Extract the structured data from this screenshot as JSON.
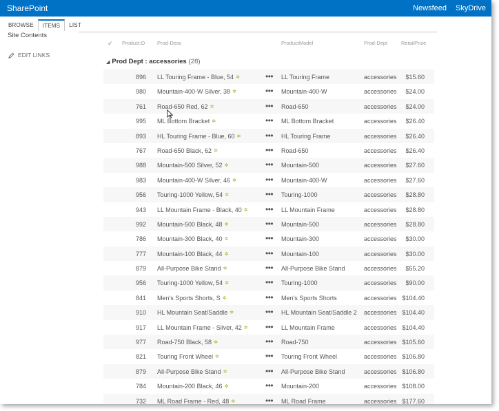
{
  "suitebar": {
    "brand": "SharePoint",
    "links": [
      "Newsfeed",
      "SkyDrive"
    ]
  },
  "ribbon": {
    "tabs": [
      "BROWSE",
      "ITEMS",
      "LIST"
    ],
    "selected_tab": "ITEMS"
  },
  "nav": {
    "site_contents": "Site Contents",
    "edit_links": "EDIT LINKS"
  },
  "columns": {
    "check": "✓",
    "id": "Product:D",
    "desc": "Prod-Desc",
    "model": "ProductModel",
    "dept": "Prod-Dept",
    "price": "RetailPrize"
  },
  "group": {
    "label": "Prod Dept : accessories",
    "count": "(28)"
  },
  "rows": [
    {
      "id": "896",
      "desc": "LL Touring Frame - Blue, 54",
      "model": "LL Touring Frame",
      "dept": "accessories",
      "price": "$15.60"
    },
    {
      "id": "980",
      "desc": "Mountain-400-W Silver, 38",
      "model": "Mountain-400-W",
      "dept": "accessories",
      "price": "$24.00"
    },
    {
      "id": "761",
      "desc": "Road-650 Red, 62",
      "model": "Road-650",
      "dept": "accessories",
      "price": "$24.00"
    },
    {
      "id": "995",
      "desc": "ML Bottom Bracket",
      "model": "ML Bottom Bracket",
      "dept": "accessories",
      "price": "$26.40"
    },
    {
      "id": "893",
      "desc": "HL Touring Frame - Blue, 60",
      "model": "HL Touring Frame",
      "dept": "accessories",
      "price": "$26.40"
    },
    {
      "id": "767",
      "desc": "Road-650 Black, 62",
      "model": "Road-650",
      "dept": "accessories",
      "price": "$26.40"
    },
    {
      "id": "988",
      "desc": "Mountain-500 Silver, 52",
      "model": "Mountain-500",
      "dept": "accessories",
      "price": "$27.60"
    },
    {
      "id": "983",
      "desc": "Mountain-400-W Silver, 46",
      "model": "Mountain-400-W",
      "dept": "accessories",
      "price": "$27.60"
    },
    {
      "id": "956",
      "desc": "Touring-1000 Yellow, 54",
      "model": "Touring-1000",
      "dept": "accessories",
      "price": "$28.80"
    },
    {
      "id": "943",
      "desc": "LL Mountain Frame - Black, 40",
      "model": "LL Mountain Frame",
      "dept": "accessories",
      "price": "$28.80"
    },
    {
      "id": "992",
      "desc": "Mountain-500 Black, 48",
      "model": "Mountain-500",
      "dept": "accessories",
      "price": "$28.80"
    },
    {
      "id": "786",
      "desc": "Mountain-300 Black, 40",
      "model": "Mountain-300",
      "dept": "accessories",
      "price": "$30.00"
    },
    {
      "id": "777",
      "desc": "Mountain-100 Black, 44",
      "model": "Mountain-100",
      "dept": "accessories",
      "price": "$30.00"
    },
    {
      "id": "879",
      "desc": "All-Purpose Bike Stand",
      "model": "All-Purpose Bike Stand",
      "dept": "accessories",
      "price": "$55.20"
    },
    {
      "id": "956",
      "desc": "Touring-1000 Yellow, 54",
      "model": "Touring-1000",
      "dept": "accessories",
      "price": "$90.00"
    },
    {
      "id": "841",
      "desc": "Men's Sports Shorts, S",
      "model": "Men's Sports Shorts",
      "dept": "accessories",
      "price": "$104.40"
    },
    {
      "id": "910",
      "desc": "HL Mountain Seat/Saddle",
      "model": "HL Mountain Seat/Saddle 2",
      "dept": "accessories",
      "price": "$104.40"
    },
    {
      "id": "917",
      "desc": "LL Mountain Frame - Silver, 42",
      "model": "LL Mountain Frame",
      "dept": "accessories",
      "price": "$104.40"
    },
    {
      "id": "977",
      "desc": "Road-750 Black, 58",
      "model": "Road-750",
      "dept": "accessories",
      "price": "$105.60"
    },
    {
      "id": "821",
      "desc": "Touring Front Wheel",
      "model": "Touring Front Wheel",
      "dept": "accessories",
      "price": "$106.80"
    },
    {
      "id": "879",
      "desc": "All-Purpose Bike Stand",
      "model": "All-Purpose Bike Stand",
      "dept": "accessories",
      "price": "$106.80"
    },
    {
      "id": "784",
      "desc": "Mountain-200 Black, 46",
      "model": "Mountain-200",
      "dept": "accessories",
      "price": "$108.00"
    },
    {
      "id": "732",
      "desc": "ML Road Frame - Red, 48",
      "model": "ML Road Frame",
      "dept": "accessories",
      "price": "$177.60"
    }
  ],
  "row_menu_glyph": "•••",
  "new_item_glyph": "✲",
  "colors": {
    "suitebar": "#0072c6",
    "new_badge": "#8cbf26"
  }
}
